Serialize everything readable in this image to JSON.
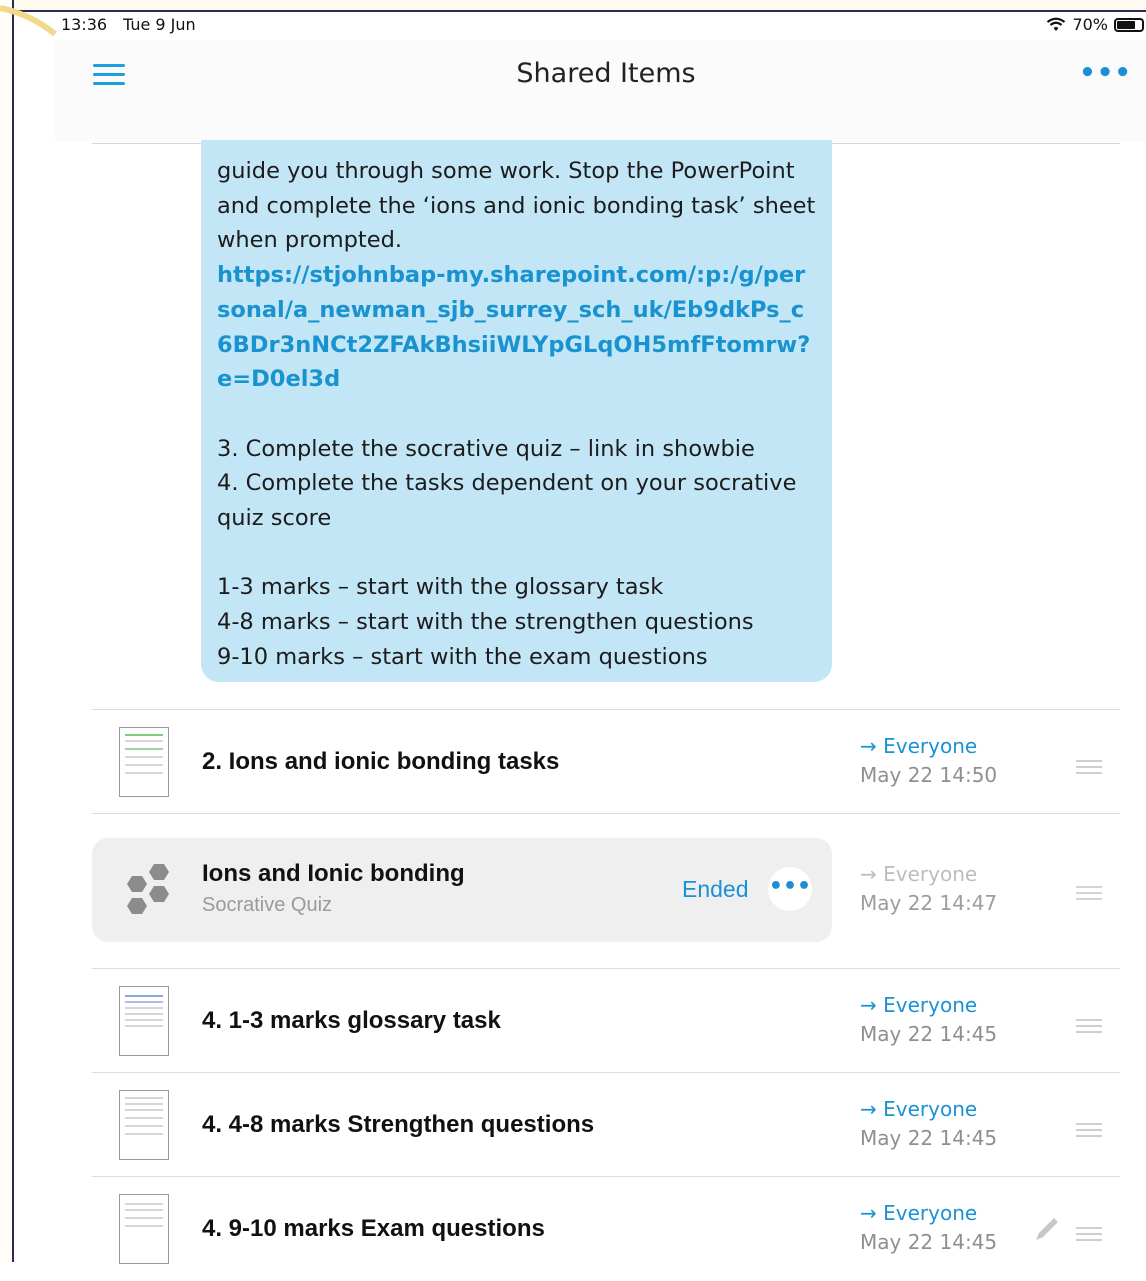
{
  "status_bar": {
    "time": "13:36",
    "date": "Tue 9 Jun",
    "battery": "70%",
    "battery_level": 0.7
  },
  "nav": {
    "title": "Shared Items",
    "menu_icon": "hamburger-menu-icon",
    "more_icon": "more-dots-icon",
    "more_glyph": "•••"
  },
  "message": {
    "lines": [
      "guide you through some work. Stop the PowerPoint",
      "and complete the ‘ions and ionic bonding task’ sheet",
      "when prompted."
    ],
    "link": "https://stjohnbap-my.sharepoint.com/:p:/g/personal/a_newman_sjb_surrey_sch_uk/Eb9dkPs_c6BDr3nNCt2ZFAkBhsiiWLYpGLqOH5mfFtomrw?e=D0el3d",
    "steps": [
      "3. Complete the socrative quiz – link in showbie",
      "4. Complete the tasks dependent on your socrative quiz score"
    ],
    "marks": [
      "1-3 marks – start with the glossary task",
      "4-8 marks – start with the strengthen questions",
      "9-10 marks – start with the exam questions"
    ]
  },
  "items": [
    {
      "title": "2. Ions and ionic bonding tasks",
      "audience": "→ Everyone",
      "date": "May 22 14:50"
    },
    {
      "title": "4. 1-3 marks glossary task",
      "audience": "→ Everyone",
      "date": "May 22 14:45"
    },
    {
      "title": "4. 4-8 marks Strengthen questions",
      "audience": "→ Everyone",
      "date": "May 22 14:45"
    },
    {
      "title": "4. 9-10 marks Exam questions",
      "audience": "→ Everyone",
      "date": "May 22 14:45"
    }
  ],
  "quiz": {
    "title": "Ions and Ionic bonding",
    "subtitle": "Socrative Quiz",
    "status": "Ended",
    "more_glyph": "•••",
    "audience": "→ Everyone",
    "date": "May 22 14:47"
  },
  "colors": {
    "accent": "#1a92d4",
    "bubble": "#c3e6f7",
    "card": "#efefef"
  }
}
